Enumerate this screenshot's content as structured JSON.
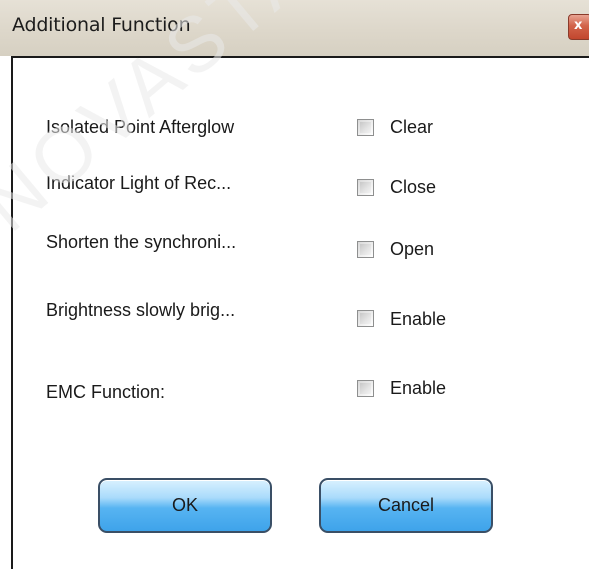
{
  "window": {
    "title": "Additional Function",
    "close_icon": "close-icon",
    "close_glyph": "x",
    "accent_color": "#3ea3ea"
  },
  "rows": [
    {
      "label": "Isolated Point Afterglow",
      "option": "Clear",
      "checked": false
    },
    {
      "label": "Indicator Light of Rec...",
      "option": "Close",
      "checked": false
    },
    {
      "label": "Shorten the synchroni...",
      "option": "Open",
      "checked": false
    },
    {
      "label": "Brightness slowly brig...",
      "option": "Enable",
      "checked": false
    },
    {
      "label": "EMC Function:",
      "option": "Enable",
      "checked": false
    }
  ],
  "buttons": {
    "ok": "OK",
    "cancel": "Cancel"
  },
  "watermark": "NOVASTAR"
}
